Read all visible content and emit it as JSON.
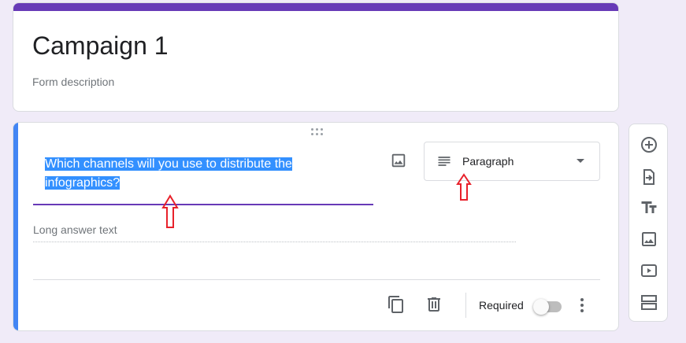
{
  "form": {
    "title": "Campaign 1",
    "description": "Form description"
  },
  "question": {
    "text": "Which channels will you use to distribute the infographics?",
    "type": "Paragraph",
    "answer_placeholder": "Long answer text",
    "required_label": "Required",
    "required": false
  },
  "side_toolbar": {
    "icons": [
      "add-question-icon",
      "import-questions-icon",
      "add-title-icon",
      "add-image-icon",
      "add-video-icon",
      "add-section-icon"
    ]
  },
  "annotations": {
    "arrow_color": "#e8212b"
  },
  "colors": {
    "accent": "#673ab7",
    "active_bar": "#4285f4",
    "selection": "#3390ff"
  }
}
